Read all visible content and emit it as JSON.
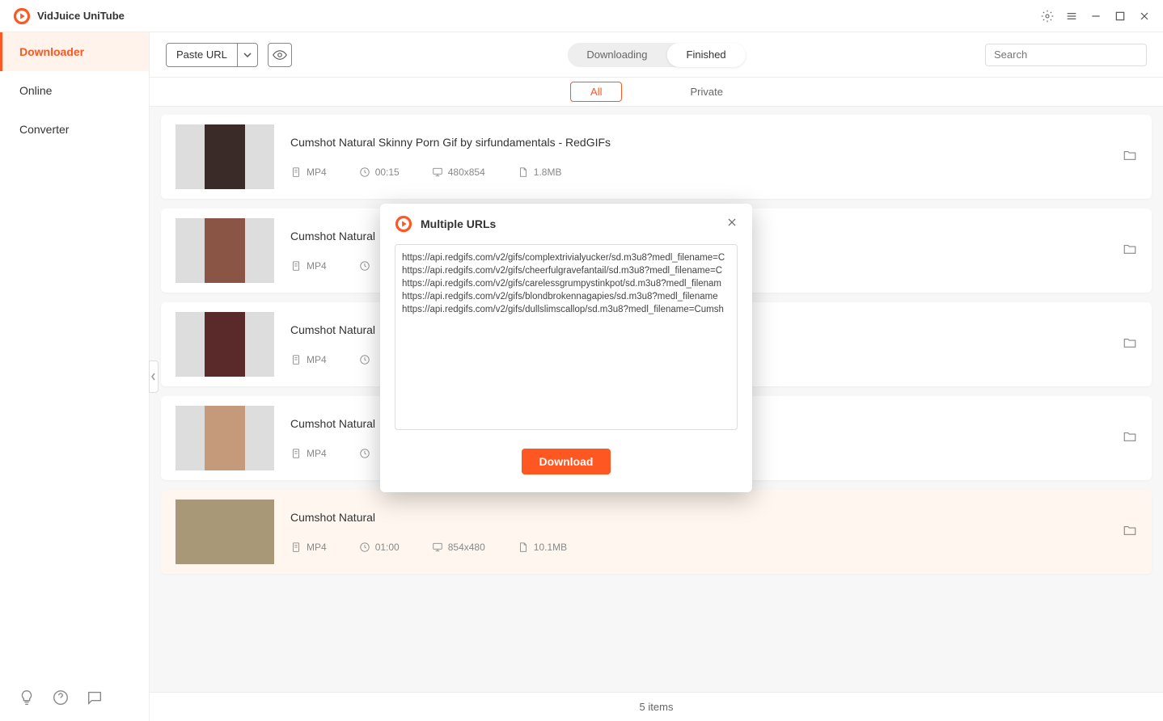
{
  "app": {
    "name": "VidJuice UniTube"
  },
  "sidebar": {
    "items": [
      {
        "label": "Downloader",
        "active": true
      },
      {
        "label": "Online",
        "active": false
      },
      {
        "label": "Converter",
        "active": false
      }
    ]
  },
  "toolbar": {
    "paste_label": "Paste URL",
    "segments": [
      {
        "label": "Downloading",
        "active": false
      },
      {
        "label": "Finished",
        "active": true
      }
    ],
    "search_placeholder": "Search"
  },
  "filters": [
    {
      "label": "All",
      "active": true
    },
    {
      "label": "Private",
      "active": false
    }
  ],
  "items": [
    {
      "title": "Cumshot Natural Skinny Porn Gif by sirfundamentals - RedGIFs",
      "format": "MP4",
      "duration": "00:15",
      "resolution": "480x854",
      "size": "1.8MB",
      "thumb": "t1"
    },
    {
      "title": "Cumshot Natural",
      "format": "MP4",
      "duration": "",
      "resolution": "",
      "size": "",
      "thumb": "t2"
    },
    {
      "title": "Cumshot Natural",
      "format": "MP4",
      "duration": "",
      "resolution": "",
      "size": "",
      "thumb": "t3"
    },
    {
      "title": "Cumshot Natural",
      "format": "MP4",
      "duration": "",
      "resolution": "",
      "size": "",
      "thumb": "t4"
    },
    {
      "title": "Cumshot Natural",
      "format": "MP4",
      "duration": "01:00",
      "resolution": "854x480",
      "size": "10.1MB",
      "thumb": "t5",
      "hover": true
    }
  ],
  "statusbar": {
    "count_label": "5 items"
  },
  "modal": {
    "title": "Multiple URLs",
    "urls": "https://api.redgifs.com/v2/gifs/complextrivialyucker/sd.m3u8?medl_filename=C\nhttps://api.redgifs.com/v2/gifs/cheerfulgravefantail/sd.m3u8?medl_filename=C\nhttps://api.redgifs.com/v2/gifs/carelessgrumpystinkpot/sd.m3u8?medl_filenam\nhttps://api.redgifs.com/v2/gifs/blondbrokennagapies/sd.m3u8?medl_filename\nhttps://api.redgifs.com/v2/gifs/dullslimscallop/sd.m3u8?medl_filename=Cumsh",
    "download_label": "Download"
  }
}
